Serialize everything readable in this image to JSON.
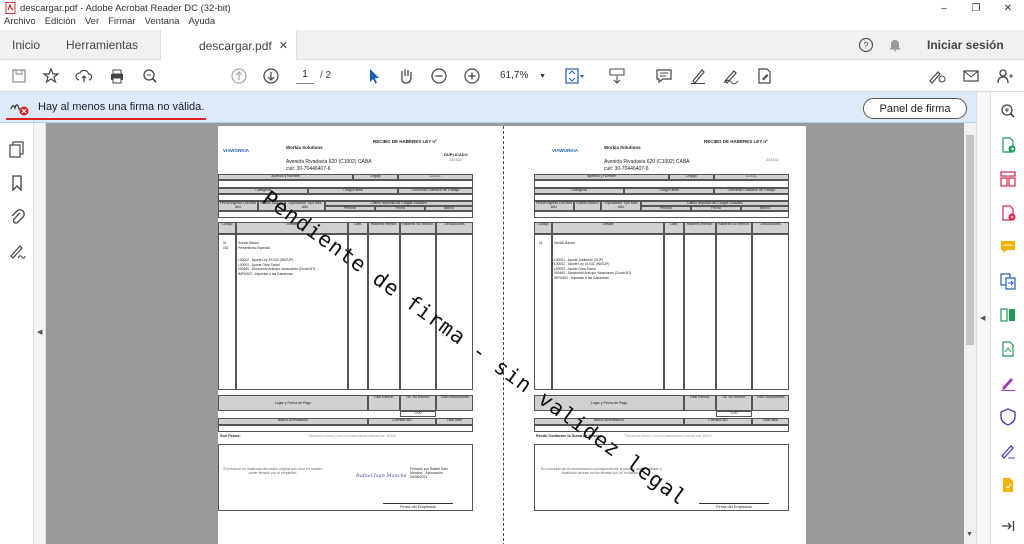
{
  "window": {
    "title": "descargar.pdf - Adobe Acrobat Reader DC (32-bit)"
  },
  "menu": [
    "Archivo",
    "Edición",
    "Ver",
    "Firmar",
    "Ventana",
    "Ayuda"
  ],
  "tabs": {
    "home": "Inicio",
    "tools": "Herramientas",
    "doc": "descargar.pdf"
  },
  "header": {
    "signin": "Iniciar sesión"
  },
  "toolbar": {
    "page_current": "1",
    "page_total": "/ 2",
    "zoom": "61,7%"
  },
  "sigbar": {
    "message": "Hay al menos una firma no válida.",
    "panel_button": "Panel de firma"
  },
  "receipt": {
    "title": "RECIBO DE HABERES LEY nº",
    "company_logo": "VIAWORKIA",
    "company": "Workia Solutions",
    "address": "Avenida Rivadavia 620 (C1002)  CABA",
    "cuit": "cuit: 30-70446407-6",
    "copy_label_left": "DUPLICADO",
    "number": "332462",
    "headers": {
      "name": "Apellido y Nombre",
      "legajo": "Legajo",
      "cuil": "C.U.I.L.",
      "category": "Categoría",
      "position": "Cargo/Tarea",
      "agreement": "Convenio Colectivo de Trabajo",
      "start_date": "Fecha Ingreso Día Mes Año",
      "salary": "Sueldo Básico",
      "settlement": "Liquidación Tipo Mes Año",
      "last_deposit": "Ultimo depósito de Cargas Sociales",
      "period": "Período",
      "date": "Fecha",
      "bank": "Banco",
      "code": "Código",
      "detail": "Detalle",
      "qty": "Cant.",
      "rem": "Haberes Remun.",
      "norem": "Haberes No Remun.",
      "ded": "Deducciones",
      "place": "Lugar y Fecha de Pago",
      "total_rem": "Total Remun.",
      "total_norem": "Tot. No Remun.",
      "total_ded": "Total Deducciones",
      "bank_acc": "Banco Acreditación",
      "cbu": "Cuenta/CBU",
      "net": "Total Neto",
      "employee_sig": "Firma del Empleado"
    },
    "items_left": [
      {
        "code": "01",
        "detail": "Sueldo Básico"
      },
      {
        "code": "002",
        "detail": "Presentismo Especial"
      },
      {
        "code": "",
        "detail": "L00002 - Aporte Ley 19.032 (INSSJP)"
      },
      {
        "code": "",
        "detail": "L00003 - Aporte Obra Social"
      },
      {
        "code": "",
        "detail": "000469 - Descuento Anticipo Vacaciones (Cuota 5/7)"
      },
      {
        "code": "",
        "detail": "IMPU503 - Impuesto a las Ganancias"
      }
    ],
    "items_right": [
      {
        "code": "01",
        "detail": "Sueldo Básico"
      },
      {
        "code": "",
        "detail": "L00001 - Aporte Jubilación (SIJP)"
      },
      {
        "code": "",
        "detail": "L00002 - Aporte Ley 19.032 (INSSJP)"
      },
      {
        "code": "",
        "detail": "L00003 - Aporte Obra Social"
      },
      {
        "code": "",
        "detail": "000469 - Descuento Anticipo Vacaciones (Cuota 5/7)"
      },
      {
        "code": "",
        "detail": "IMPU503 - Impuesto a las Ganancias"
      }
    ],
    "zero": "0,00",
    "son_pesos": "Son Pesos:",
    "recibi": "Recibí Conforme la Suma de Pesos:",
    "amount_words": "Trescientos treinta y dos mil cuatrocientos veintiún con 38/100",
    "note_left": "El presente es duplicado del recibo original que obra en nuestro poder firmado por el empleado.",
    "note_right": "En concepto de mi remuneración correspondiente al período arriba indicado y duplicado de este recibo firmado por mi empleador.",
    "signer_script": "Rafael Ivan Monche",
    "signer_text": "Firmado por Rafael Ivan Monche - Aprovación 26/08/2021"
  },
  "watermark": "Pendiente de firma - sin validez legal"
}
